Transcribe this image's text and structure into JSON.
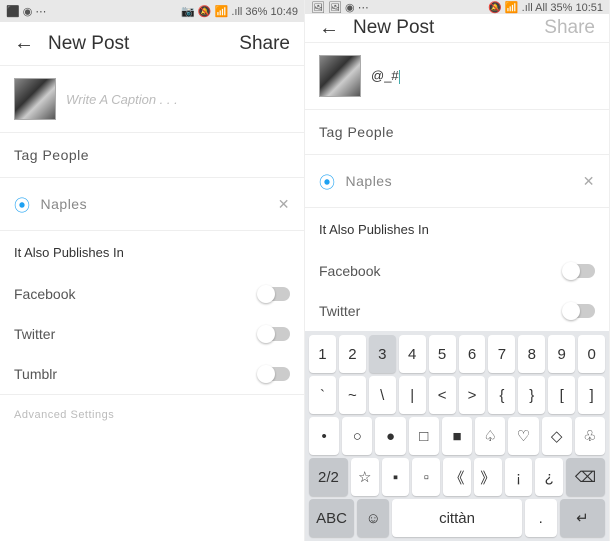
{
  "left": {
    "status": {
      "left": "⬛ ◉ ⋯",
      "right": "📷 🔕 📶 .ıll 36% 10:49"
    },
    "header": {
      "title": "New Post",
      "share": "Share"
    },
    "caption_placeholder": "Write A Caption . . .",
    "tag": "Tag People",
    "location": "Naples",
    "publishes": "It Also Publishes In",
    "nets": [
      "Facebook",
      "Twitter",
      "Tumblr"
    ],
    "advanced": "Advanced Settings"
  },
  "right": {
    "status": {
      "left": "🖼 🖼 ◉ ⋯",
      "right": "🔕 📶 .ıll All 35% 10:51"
    },
    "header": {
      "title": "New Post",
      "share": "Share"
    },
    "caption_value": "@_#",
    "tag": "Tag People",
    "location": "Naples",
    "publishes": "It Also Publishes In",
    "nets": [
      "Facebook",
      "Twitter"
    ],
    "kb": {
      "r1": [
        "1",
        "2",
        "3",
        "4",
        "5",
        "6",
        "7",
        "8",
        "9",
        "0"
      ],
      "r2": [
        "`",
        "~",
        "\\",
        "|",
        "<",
        ">",
        "{",
        "}",
        "[",
        "]"
      ],
      "r3": [
        "•",
        "○",
        "●",
        "□",
        "■",
        "♤",
        "♡",
        "◇",
        "♧"
      ],
      "r4": [
        "2/2",
        "☆",
        "▪",
        "▫",
        "《",
        "》",
        "¡",
        "¿",
        "⌫"
      ],
      "r5": [
        "ABC",
        "☺",
        "cittàn",
        ".",
        "↵"
      ]
    }
  }
}
